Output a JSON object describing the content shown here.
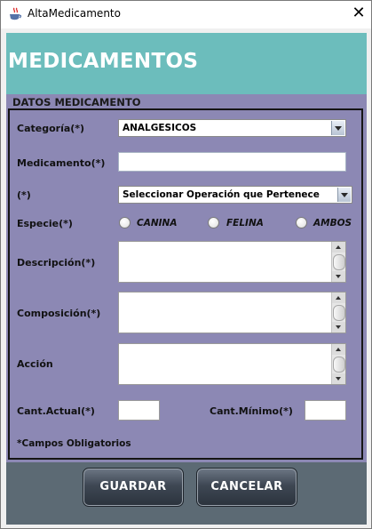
{
  "window": {
    "title": "AltaMedicamento",
    "close_glyph": "✕"
  },
  "header": {
    "title": "MEDICAMENTOS"
  },
  "section": {
    "title": "DATOS MEDICAMENTO"
  },
  "fields": {
    "categoria": {
      "label": "Categoría(*)",
      "selected": "ANALGESICOS"
    },
    "medicamento": {
      "label": "Medicamento(*)",
      "value": ""
    },
    "operacion": {
      "label": "(*)",
      "selected": "Seleccionar Operación que Pertenece"
    },
    "especie": {
      "label": "Especie(*)",
      "options": [
        "CANINA",
        "FELINA",
        "AMBOS"
      ],
      "selected": null
    },
    "descripcion": {
      "label": "Descripción(*)",
      "value": ""
    },
    "composicion": {
      "label": "Composición(*)",
      "value": ""
    },
    "accion": {
      "label": "Acción",
      "value": ""
    },
    "cant_actual": {
      "label": "Cant.Actual(*)",
      "value": ""
    },
    "cant_minimo": {
      "label": "Cant.Mínimo(*)",
      "value": ""
    }
  },
  "footnote": "*Campos Obligatorios",
  "buttons": {
    "guardar": "GUARDAR",
    "cancelar": "CANCELAR"
  },
  "icons": {
    "app_icon": "java-coffee-cup-icon",
    "close_icon": "close-icon"
  },
  "colors": {
    "header_band": "#6cbdbc",
    "form_background": "#8c88b4",
    "button_bar": "#5c6a74"
  }
}
